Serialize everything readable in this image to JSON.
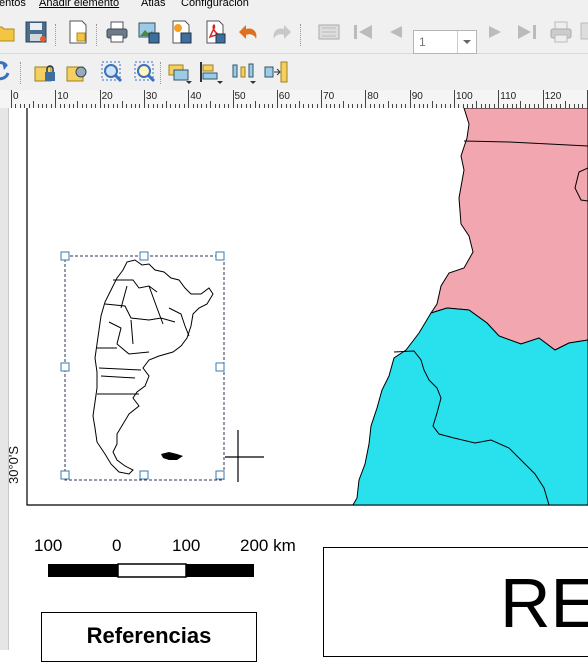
{
  "menubar": {
    "items": [
      "entos",
      "Añadir elemento",
      "Atlas",
      "Configuración"
    ]
  },
  "toolbar": {
    "page_number_value": "1",
    "icons_row1": [
      "open-folder-icon",
      "save-icon",
      "new-layout-icon",
      "print-icon",
      "export-image-icon",
      "export-svg-icon",
      "export-pdf-icon",
      "export-raster-icon",
      "undo-icon",
      "redo-icon",
      "atlas-preview-icon",
      "first-feature-icon",
      "previous-feature-icon",
      "page-number-select",
      "next-feature-icon",
      "last-feature-icon",
      "print-atlas-icon",
      "export-atlas-icon"
    ],
    "icons_row2": [
      "refresh-icon",
      "lock-items-icon",
      "unlock-items-icon",
      "zoom-selection-icon",
      "zoom-full-icon",
      "raise-items-icon",
      "align-items-icon",
      "distribute-items-icon",
      "resize-items-icon"
    ]
  },
  "ruler": {
    "labels": [
      "0",
      "10",
      "20",
      "30",
      "40",
      "50",
      "60",
      "70",
      "80",
      "90",
      "100",
      "110",
      "120"
    ]
  },
  "map": {
    "latitude_label": "30°0'S",
    "region_colors": {
      "pink": "#f2a7b0",
      "cyan": "#29e0ed"
    }
  },
  "scalebar": {
    "labels": [
      "100",
      "0",
      "100",
      "200 km"
    ]
  },
  "legend": {
    "title": "Referencias"
  },
  "title_box": {
    "text": "RE"
  }
}
